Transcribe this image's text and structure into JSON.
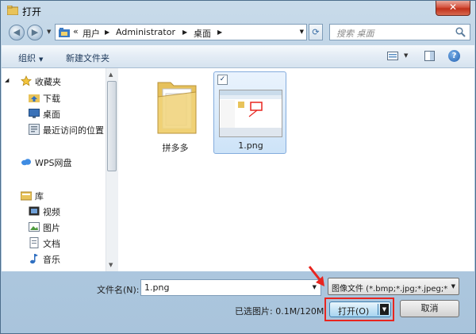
{
  "window": {
    "title": "打开",
    "close_glyph": "✕"
  },
  "nav": {
    "back_glyph": "◀",
    "forward_glyph": "▶",
    "breadcrumb_prefix": "«",
    "breadcrumb": [
      "用户",
      "Administrator",
      "桌面"
    ],
    "search_placeholder": "搜索 桌面"
  },
  "toolbar": {
    "organize": "组织",
    "new_folder": "新建文件夹",
    "help": "?"
  },
  "navpane": {
    "favorites": "收藏夹",
    "downloads": "下载",
    "desktop": "桌面",
    "recent": "最近访问的位置",
    "wps": "WPS网盘",
    "libraries": "库",
    "videos": "视频",
    "pictures": "图片",
    "documents": "文档",
    "music": "音乐"
  },
  "files": [
    {
      "name": "拼多多",
      "type": "folder",
      "selected": false
    },
    {
      "name": "1.png",
      "type": "image",
      "selected": true
    }
  ],
  "bottom": {
    "filename_label": "文件名(N):",
    "filename_value": "1.png",
    "filter": "图像文件 (*.bmp;*.jpg;*.jpeg;*",
    "status": "已选图片: 0.1M/120M",
    "open_label": "打开(O)",
    "cancel_label": "取消"
  },
  "colors": {
    "highlight": "#e8251f",
    "accent": "#3c7fb1",
    "selection": "#cde3f8"
  }
}
